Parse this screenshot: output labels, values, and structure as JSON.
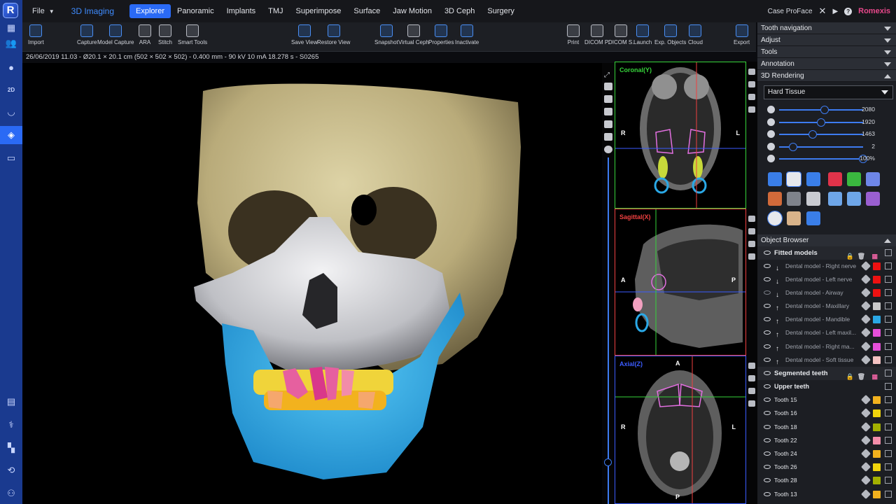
{
  "rail": {
    "logo": "R",
    "items": [
      "images-icon",
      "users-icon",
      "patient-icon",
      "2d-icon",
      "dental-icon",
      "3d-icon",
      "film-icon",
      "ceph-icon",
      "treatment-icon",
      "settings-icon",
      "export-icon",
      "user-network-icon"
    ]
  },
  "topbar": {
    "file_label": "File",
    "module_label": "3D Imaging",
    "tabs": [
      "Explorer",
      "Panoramic",
      "Implants",
      "TMJ",
      "Superimpose",
      "Surface",
      "Jaw Motion",
      "3D Ceph",
      "Surgery"
    ],
    "active_tab": "Explorer",
    "case_label": "Case ProFace",
    "brand": "Romexis"
  },
  "toolbar": {
    "import": "Import",
    "capture": "Capture",
    "model_capture": "Model Capture",
    "ara": "ARA",
    "stitch": "Stitch",
    "smart_tools": "Smart Tools",
    "save_view": "Save View",
    "restore_view": "Restore View",
    "snapshot": "Snapshot",
    "virtual_ceph": "Virtual Ceph",
    "properties": "Properties",
    "inactivate": "Inactivate",
    "print": "Print",
    "dicom_p": "DICOM P.",
    "dicom_s": "DICOM S.",
    "launch": "Launch",
    "exp_objects": "Exp. Objects",
    "cloud": "Cloud",
    "export": "Export"
  },
  "status": "26/06/2019 11.03 - Ø20.1 × 20.1 cm (502 × 502 × 502) - 0.400 mm - 90 kV 10 mA 18.278 s - S0265",
  "panes": {
    "coronal": {
      "label": "Coronal(Y)",
      "left": "R",
      "right": "L",
      "color": "#36d43a"
    },
    "sagittal": {
      "label": "Sagittal(X)",
      "left": "A",
      "right": "P",
      "color": "#f04040"
    },
    "axial": {
      "label": "Axial(Z)",
      "top": "A",
      "bottom": "P",
      "left": "R",
      "right": "L",
      "color": "#3b5cff"
    }
  },
  "right_panel": {
    "sections": [
      "Tooth navigation",
      "Adjust",
      "Tools",
      "Annotation",
      "3D Rendering"
    ],
    "rendering_mode": "Hard Tissue",
    "sliders": [
      {
        "value": "2080",
        "level": 0.52
      },
      {
        "value": "1920",
        "level": 0.47
      },
      {
        "value": "1463",
        "level": 0.37
      },
      {
        "value": "2",
        "level": 0.12
      },
      {
        "value": "100%",
        "level": 1.0
      }
    ],
    "object_browser": "Object Browser",
    "fitted_models": "Fitted models",
    "models": [
      {
        "name": "Dental model - Right nerve",
        "color": "#ee1111",
        "visible": true,
        "dir": "down"
      },
      {
        "name": "Dental model - Left nerve",
        "color": "#ee1111",
        "visible": true,
        "dir": "down"
      },
      {
        "name": "Dental model - Airway",
        "color": "#ee1111",
        "visible": false,
        "dir": "down"
      },
      {
        "name": "Dental model - Maxillary",
        "color": "#c9c9c9",
        "visible": true,
        "dir": "up"
      },
      {
        "name": "Dental model - Mandible",
        "color": "#2aa8e6",
        "visible": true,
        "dir": "up"
      },
      {
        "name": "Dental model - Left maxil...",
        "color": "#e64fd9",
        "visible": true,
        "dir": "up"
      },
      {
        "name": "Dental model - Right ma...",
        "color": "#e64fd9",
        "visible": true,
        "dir": "up"
      },
      {
        "name": "Dental model - Soft tissue",
        "color": "#f4c2c2",
        "visible": true,
        "dir": "up"
      }
    ],
    "segmented_teeth": "Segmented teeth",
    "upper_teeth": "Upper teeth",
    "teeth": [
      {
        "name": "Tooth 15",
        "color": "#f2b21e"
      },
      {
        "name": "Tooth 16",
        "color": "#f0d40c"
      },
      {
        "name": "Tooth 18",
        "color": "#a3b000"
      },
      {
        "name": "Tooth 22",
        "color": "#f28ca8"
      },
      {
        "name": "Tooth 24",
        "color": "#f2b21e"
      },
      {
        "name": "Tooth 26",
        "color": "#f0d40c"
      },
      {
        "name": "Tooth 28",
        "color": "#a3b000"
      },
      {
        "name": "Tooth 13",
        "color": "#f2b21e"
      }
    ]
  }
}
